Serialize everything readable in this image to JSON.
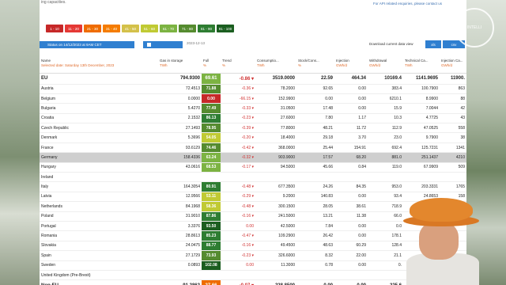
{
  "header": {
    "top_left_note": "ing capacities.",
    "top_right_note": "For API related enquiries, please contact us",
    "logo_text": "INTELLI"
  },
  "legend": [
    {
      "label": "1 - 10",
      "color": "#c62828"
    },
    {
      "label": "11 - 20",
      "color": "#e53935"
    },
    {
      "label": "21 - 30",
      "color": "#ef6c00"
    },
    {
      "label": "31 - 40",
      "color": "#f57c00"
    },
    {
      "label": "41 - 50",
      "color": "#d4c14a"
    },
    {
      "label": "51 - 60",
      "color": "#c0ca33"
    },
    {
      "label": "61 - 70",
      "color": "#7cb342"
    },
    {
      "label": "71 - 80",
      "color": "#558b2f"
    },
    {
      "label": "81 - 90",
      "color": "#2e7d32"
    },
    {
      "label": "91 - 100",
      "color": "#1b5e20"
    }
  ],
  "controls": {
    "status_label": "Status on 14/12/2023 at 9AM CET",
    "date_value": "2023-12-13",
    "download_label": "Download current data view",
    "download_btn": "xls",
    "download_btn2": "csv"
  },
  "columns": {
    "name": "Name",
    "name_sub": "Selected date: Saturday 13th December, 2023",
    "gas": "Gas in storage",
    "gas_unit": "TWh",
    "full": "Full",
    "full_unit": "%",
    "trend": "Trend",
    "trend_unit": "%",
    "consumption": "Consumptio...",
    "consumption_unit": "TWh",
    "stock": "Stock/Cons...",
    "stock_unit": "%",
    "injection": "Injection",
    "injection_unit": "GWh/d",
    "withdrawal": "Withdrawal",
    "withdrawal_unit": "GWh/d",
    "technical": "Technical Ca...",
    "technical_unit": "TWh",
    "injcap": "Injection Ca...",
    "injcap_unit": "GWh/d"
  },
  "rows": [
    {
      "name": "EU",
      "type": "eu",
      "gas": "794.9300",
      "full": "69.61",
      "full_color": "#7cb342",
      "trend": "-0.86 ▾",
      "cons": "3519.0000",
      "stock": "22.59",
      "inj": "464.34",
      "wd": "10169.4",
      "tech": "1141.9695",
      "injcap": "11900."
    },
    {
      "name": "Austria",
      "type": "sub",
      "gas": "72.4513",
      "full": "71.88",
      "full_color": "#558b2f",
      "trend": "-0.36 ▾",
      "cons": "78.2000",
      "stock": "92.65",
      "inj": "0.00",
      "wd": "383.4",
      "tech": "100.7900",
      "injcap": "863"
    },
    {
      "name": "Belgium",
      "type": "sub",
      "gas": "0.0000",
      "full": "0.00",
      "full_color": "#c62828",
      "trend": "-66.15 ▾",
      "cons": "152.9900",
      "stock": "0.00",
      "inj": "0.00",
      "wd": "6210.1",
      "tech": "8.9900",
      "injcap": "88"
    },
    {
      "name": "Bulgaria",
      "type": "sub",
      "gas": "5.4270",
      "full": "77.49",
      "full_color": "#558b2f",
      "trend": "-0.33 ▾",
      "cons": "31.0500",
      "stock": "17.48",
      "inj": "0.00",
      "wd": "15.9",
      "tech": "7.0044",
      "injcap": "42"
    },
    {
      "name": "Croatia",
      "type": "sub",
      "gas": "2.1532",
      "full": "86.13",
      "full_color": "#2e7d32",
      "trend": "-0.23 ▾",
      "cons": "27.6000",
      "stock": "7.80",
      "inj": "1.17",
      "wd": "10.3",
      "tech": "4.7725",
      "injcap": "43"
    },
    {
      "name": "Czech Republic",
      "type": "sub",
      "gas": "27.1493",
      "full": "78.95",
      "full_color": "#558b2f",
      "trend": "-0.39 ▾",
      "cons": "77.8000",
      "stock": "48.21",
      "inj": "11.72",
      "wd": "112.9",
      "tech": "47.0525",
      "injcap": "558"
    },
    {
      "name": "Denmark",
      "type": "sub",
      "gas": "5.3696",
      "full": "54.05",
      "full_color": "#c0ca33",
      "trend": "-0.20 ▾",
      "cons": "18.4000",
      "stock": "29.18",
      "inj": "3.70",
      "wd": "23.0",
      "tech": "9.7900",
      "injcap": "38"
    },
    {
      "name": "France",
      "type": "sub",
      "gas": "93.6129",
      "full": "74.46",
      "full_color": "#558b2f",
      "trend": "-0.42 ▾",
      "cons": "368.0000",
      "stock": "25.44",
      "inj": "154.91",
      "wd": "692.4",
      "tech": "125.7231",
      "injcap": "1341"
    },
    {
      "name": "Germany",
      "type": "sel",
      "gas": "158.4336",
      "full": "63.24",
      "full_color": "#7cb342",
      "trend": "-0.32 ▾",
      "cons": "903.9000",
      "stock": "17.57",
      "inj": "68.20",
      "wd": "881.0",
      "tech": "251.1437",
      "injcap": "4210"
    },
    {
      "name": "Hungary",
      "type": "sub",
      "gas": "43.0616",
      "full": "68.53",
      "full_color": "#7cb342",
      "trend": "-0.17 ▾",
      "cons": "94.5000",
      "stock": "45.66",
      "inj": "0.84",
      "wd": "119.0",
      "tech": "67.9909",
      "injcap": "509"
    },
    {
      "name": "Ireland",
      "type": "sub",
      "gas": "",
      "full": "",
      "full_color": "",
      "trend": "",
      "cons": "",
      "stock": "",
      "inj": "",
      "wd": "",
      "tech": "",
      "injcap": ""
    },
    {
      "name": "Italy",
      "type": "sub",
      "gas": "164.3054",
      "full": "80.91",
      "full_color": "#2e7d32",
      "trend": "-0.48 ▾",
      "cons": "677.3500",
      "stock": "24.26",
      "inj": "84.35",
      "wd": "953.0",
      "tech": "203.3331",
      "injcap": "1765"
    },
    {
      "name": "Latvia",
      "type": "sub",
      "gas": "12.9566",
      "full": "53.11",
      "full_color": "#c0ca33",
      "trend": "-0.29 ▾",
      "cons": "9.2000",
      "stock": "140.83",
      "inj": "0.00",
      "wd": "93.4",
      "tech": "24.8653",
      "injcap": "158"
    },
    {
      "name": "Netherlands",
      "type": "sub",
      "gas": "84.1968",
      "full": "58.36",
      "full_color": "#c0ca33",
      "trend": "-0.48 ▾",
      "cons": "300.1500",
      "stock": "28.05",
      "inj": "38.61",
      "wd": "718.9",
      "tech": "144.2900",
      "injcap": ""
    },
    {
      "name": "Poland",
      "type": "sub",
      "gas": "31.9010",
      "full": "87.86",
      "full_color": "#2e7d32",
      "trend": "-0.16 ▾",
      "cons": "241.5000",
      "stock": "13.21",
      "inj": "11.38",
      "wd": "66.0",
      "tech": "36.3",
      "injcap": ""
    },
    {
      "name": "Portugal",
      "type": "sub",
      "gas": "3.3376",
      "full": "93.50",
      "full_color": "#1b5e20",
      "trend": "0.00",
      "cons": "42.5000",
      "stock": "7.84",
      "inj": "0.00",
      "wd": "0.0",
      "tech": "3.5",
      "injcap": ""
    },
    {
      "name": "Romania",
      "type": "sub",
      "gas": "28.8613",
      "full": "85.23",
      "full_color": "#2e7d32",
      "trend": "-0.47 ▾",
      "cons": "109.2900",
      "stock": "26.42",
      "inj": "0.00",
      "wd": "178.1",
      "tech": "33.",
      "injcap": ""
    },
    {
      "name": "Slovakia",
      "type": "sub",
      "gas": "24.0475",
      "full": "88.77",
      "full_color": "#2e7d32",
      "trend": "-0.16 ▾",
      "cons": "49.4500",
      "stock": "48.63",
      "inj": "60.29",
      "wd": "128.4",
      "tech": "36.",
      "injcap": ""
    },
    {
      "name": "Spain",
      "type": "sub",
      "gas": "27.1729",
      "full": "73.93",
      "full_color": "#558b2f",
      "trend": "-0.23 ▾",
      "cons": "326.6000",
      "stock": "8.32",
      "inj": "22.00",
      "wd": "21.1",
      "tech": "35.",
      "injcap": ""
    },
    {
      "name": "Sweden",
      "type": "sub",
      "gas": "0.0893",
      "full": "102.08",
      "full_color": "#1b5e20",
      "trend": "0.00",
      "cons": "11.3000",
      "stock": "0.78",
      "inj": "0.00",
      "wd": "0.",
      "tech": "",
      "injcap": ""
    },
    {
      "name": "United Kingdom (Pre-Brexit)",
      "type": "sub",
      "gas": "",
      "full": "",
      "full_color": "",
      "trend": "",
      "cons": "",
      "stock": "",
      "inj": "",
      "wd": "",
      "tech": "",
      "injcap": ""
    },
    {
      "name": "Non-EU",
      "type": "nonEU",
      "gas": "91.2862",
      "full": "27.66",
      "full_color": "#ef6c00",
      "trend": "-0.07 ▾",
      "cons": "228.8500",
      "stock": "0.00",
      "inj": "0.00",
      "wd": "225.6",
      "tech": "",
      "injcap": ""
    }
  ]
}
